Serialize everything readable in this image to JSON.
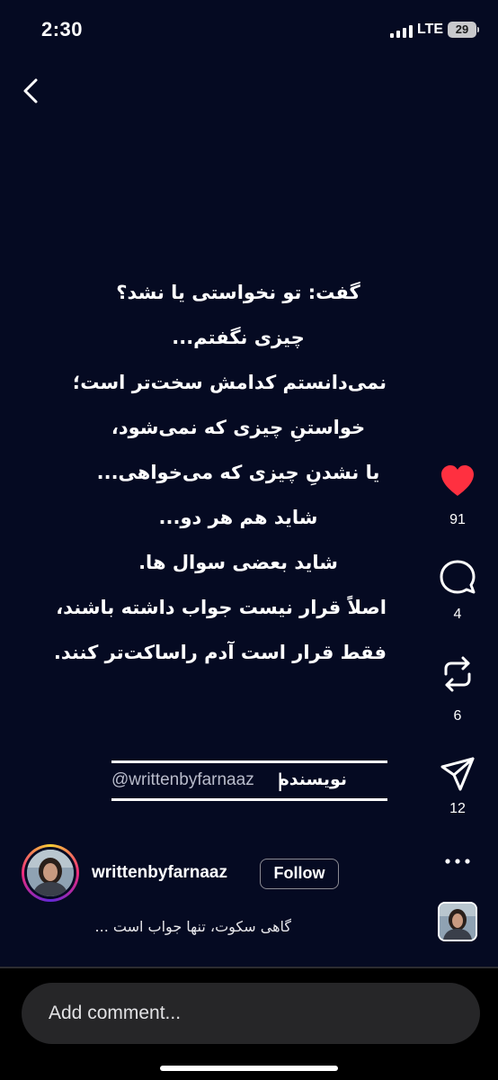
{
  "status_bar": {
    "time": "2:30",
    "network": "LTE",
    "battery": "29",
    "icons": [
      "signal-icon",
      "battery-icon"
    ]
  },
  "navigation": {
    "back_icon": "chevron-left-icon"
  },
  "poem": {
    "lines": [
      "گفت: تو نخواستی یا نشد؟",
      "چیزی نگفتم...",
      "نمی‌دانستم کدامش سخت‌تر است؛",
      "خواستنِ چیزی که نمی‌شود،",
      "یا نشدنِ چیزی که می‌خواهی...",
      "شاید هم هر دو...",
      "شاید بعضی سوال ها.",
      "اصلاً قرار نیست جواب داشته باشند،",
      "فقط قرار است آدم راساکت‌تر کنند."
    ]
  },
  "author_box": {
    "handle": "@writtenbyfarnaaz",
    "separator": "|",
    "label": "نویسنده"
  },
  "actions": {
    "like": {
      "icon": "heart-icon",
      "count": "91",
      "color": "#ff3040"
    },
    "comment": {
      "icon": "comment-icon",
      "count": "4"
    },
    "repost": {
      "icon": "repost-icon",
      "count": "6"
    },
    "share": {
      "icon": "send-icon",
      "count": "12"
    },
    "more": {
      "icon": "more-icon"
    }
  },
  "profile": {
    "username": "writtenbyfarnaaz",
    "follow_label": "Follow",
    "caption": "گاهی سکوت، تنها جواب است ..."
  },
  "comment_input": {
    "placeholder": "Add comment..."
  },
  "colors": {
    "background": "#050a22",
    "accent_like": "#ff3040",
    "story_ring": [
      "#f9ce34",
      "#ee2a7b",
      "#6228d7"
    ]
  }
}
